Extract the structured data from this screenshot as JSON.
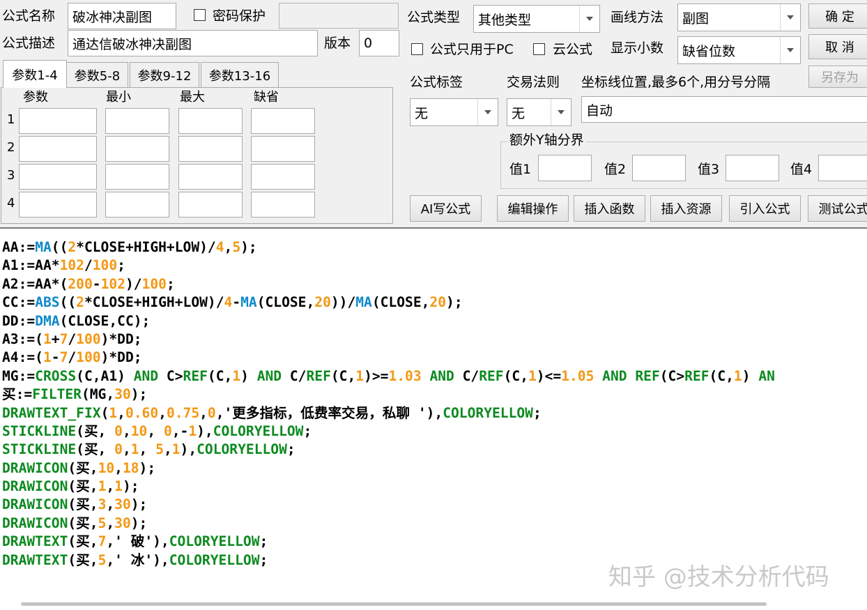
{
  "top": {
    "name_label": "公式名称",
    "name_value": "破冰神决副图",
    "password_label": "密码保护",
    "desc_label": "公式描述",
    "desc_value": "通达信破冰神决副图",
    "version_label": "版本",
    "version_value": "0",
    "type_label": "公式类型",
    "type_value": "其他类型",
    "draw_label": "画线方法",
    "draw_value": "副图",
    "pc_only_label": "公式只用于PC",
    "cloud_label": "云公式",
    "decimals_label": "显示小数",
    "decimals_value": "缺省位数"
  },
  "buttons": {
    "ok": "确  定",
    "cancel": "取  消",
    "save_as": "另存为",
    "ai": "AI写公式",
    "edit": "编辑操作",
    "insert_func": "插入函数",
    "insert_res": "插入资源",
    "import": "引入公式",
    "test": "测试公式"
  },
  "tabs": [
    "参数1-4",
    "参数5-8",
    "参数9-12",
    "参数13-16"
  ],
  "params": {
    "headers": [
      "参数",
      "最小",
      "最大",
      "缺省"
    ],
    "rows": [
      "1",
      "2",
      "3",
      "4"
    ]
  },
  "right": {
    "tag_label": "公式标签",
    "tag_value": "无",
    "trade_label": "交易法则",
    "trade_value": "无",
    "coord_label": "坐标线位置,最多6个,用分号分隔",
    "coord_value": "自动",
    "y_group_title": "额外Y轴分界",
    "y_labels": [
      "值1",
      "值2",
      "值3",
      "值4"
    ]
  },
  "code_lines": [
    [
      [
        "k",
        "AA:="
      ],
      [
        "f",
        "MA"
      ],
      [
        "k",
        "(("
      ],
      [
        "n",
        "2"
      ],
      [
        "k",
        "*CLOSE+HIGH+LOW)/"
      ],
      [
        "n",
        "4"
      ],
      [
        "k",
        ","
      ],
      [
        "n",
        "5"
      ],
      [
        "k",
        ");"
      ]
    ],
    [
      [
        "k",
        "A1:=AA*"
      ],
      [
        "n",
        "102"
      ],
      [
        "k",
        "/"
      ],
      [
        "n",
        "100"
      ],
      [
        "k",
        ";"
      ]
    ],
    [
      [
        "k",
        "A2:=AA*("
      ],
      [
        "n",
        "200"
      ],
      [
        "k",
        "-"
      ],
      [
        "n",
        "102"
      ],
      [
        "k",
        ")/"
      ],
      [
        "n",
        "100"
      ],
      [
        "k",
        ";"
      ]
    ],
    [
      [
        "k",
        "CC:="
      ],
      [
        "f",
        "ABS"
      ],
      [
        "k",
        "(("
      ],
      [
        "n",
        "2"
      ],
      [
        "k",
        "*CLOSE+HIGH+LOW)/"
      ],
      [
        "n",
        "4"
      ],
      [
        "k",
        "-"
      ],
      [
        "f",
        "MA"
      ],
      [
        "k",
        "(CLOSE,"
      ],
      [
        "n",
        "20"
      ],
      [
        "k",
        "))/"
      ],
      [
        "f",
        "MA"
      ],
      [
        "k",
        "(CLOSE,"
      ],
      [
        "n",
        "20"
      ],
      [
        "k",
        ");"
      ]
    ],
    [
      [
        "k",
        "DD:="
      ],
      [
        "f",
        "DMA"
      ],
      [
        "k",
        "(CLOSE,CC);"
      ]
    ],
    [
      [
        "k",
        "A3:=("
      ],
      [
        "n",
        "1"
      ],
      [
        "k",
        "+"
      ],
      [
        "n",
        "7"
      ],
      [
        "k",
        "/"
      ],
      [
        "n",
        "100"
      ],
      [
        "k",
        ")*DD;"
      ]
    ],
    [
      [
        "k",
        "A4:=("
      ],
      [
        "n",
        "1"
      ],
      [
        "k",
        "-"
      ],
      [
        "n",
        "7"
      ],
      [
        "k",
        "/"
      ],
      [
        "n",
        "100"
      ],
      [
        "k",
        ")*DD;"
      ]
    ],
    [
      [
        "k",
        "MG:="
      ],
      [
        "g",
        "CROSS"
      ],
      [
        "k",
        "(C,A1) "
      ],
      [
        "g",
        "AND"
      ],
      [
        "k",
        " C>"
      ],
      [
        "g",
        "REF"
      ],
      [
        "k",
        "(C,"
      ],
      [
        "n",
        "1"
      ],
      [
        "k",
        ") "
      ],
      [
        "g",
        "AND"
      ],
      [
        "k",
        " C/"
      ],
      [
        "g",
        "REF"
      ],
      [
        "k",
        "(C,"
      ],
      [
        "n",
        "1"
      ],
      [
        "k",
        ")>="
      ],
      [
        "n",
        "1.03"
      ],
      [
        "k",
        " "
      ],
      [
        "g",
        "AND"
      ],
      [
        "k",
        " C/"
      ],
      [
        "g",
        "REF"
      ],
      [
        "k",
        "(C,"
      ],
      [
        "n",
        "1"
      ],
      [
        "k",
        ")<="
      ],
      [
        "n",
        "1.05"
      ],
      [
        "k",
        " "
      ],
      [
        "g",
        "AND"
      ],
      [
        "k",
        " "
      ],
      [
        "g",
        "REF"
      ],
      [
        "k",
        "(C>"
      ],
      [
        "g",
        "REF"
      ],
      [
        "k",
        "(C,"
      ],
      [
        "n",
        "1"
      ],
      [
        "k",
        ") "
      ],
      [
        "g",
        "AN"
      ]
    ],
    [
      [
        "k",
        "买:="
      ],
      [
        "g",
        "FILTER"
      ],
      [
        "k",
        "(MG,"
      ],
      [
        "n",
        "30"
      ],
      [
        "k",
        ");"
      ]
    ],
    [
      [
        "g",
        "DRAWTEXT_FIX"
      ],
      [
        "k",
        "("
      ],
      [
        "n",
        "1"
      ],
      [
        "k",
        ","
      ],
      [
        "n",
        "0.60"
      ],
      [
        "k",
        ","
      ],
      [
        "n",
        "0.75"
      ],
      [
        "k",
        ","
      ],
      [
        "n",
        "0"
      ],
      [
        "k",
        ",'更多指标，低费率交易，私聊 '),"
      ],
      [
        "g",
        "COLORYELLOW"
      ],
      [
        "k",
        ";"
      ]
    ],
    [
      [
        "g",
        "STICKLINE"
      ],
      [
        "k",
        "(买, "
      ],
      [
        "n",
        "0"
      ],
      [
        "k",
        ","
      ],
      [
        "n",
        "10"
      ],
      [
        "k",
        ", "
      ],
      [
        "n",
        "0"
      ],
      [
        "k",
        ",-"
      ],
      [
        "n",
        "1"
      ],
      [
        "k",
        "),"
      ],
      [
        "g",
        "COLORYELLOW"
      ],
      [
        "k",
        ";"
      ]
    ],
    [
      [
        "g",
        "STICKLINE"
      ],
      [
        "k",
        "(买, "
      ],
      [
        "n",
        "0"
      ],
      [
        "k",
        ","
      ],
      [
        "n",
        "1"
      ],
      [
        "k",
        ", "
      ],
      [
        "n",
        "5"
      ],
      [
        "k",
        ","
      ],
      [
        "n",
        "1"
      ],
      [
        "k",
        "),"
      ],
      [
        "g",
        "COLORYELLOW"
      ],
      [
        "k",
        ";"
      ]
    ],
    [
      [
        "g",
        "DRAWICON"
      ],
      [
        "k",
        "(买,"
      ],
      [
        "n",
        "10"
      ],
      [
        "k",
        ","
      ],
      [
        "n",
        "18"
      ],
      [
        "k",
        ");"
      ]
    ],
    [
      [
        "g",
        "DRAWICON"
      ],
      [
        "k",
        "(买,"
      ],
      [
        "n",
        "1"
      ],
      [
        "k",
        ","
      ],
      [
        "n",
        "1"
      ],
      [
        "k",
        ");"
      ]
    ],
    [
      [
        "g",
        "DRAWICON"
      ],
      [
        "k",
        "(买,"
      ],
      [
        "n",
        "3"
      ],
      [
        "k",
        ","
      ],
      [
        "n",
        "30"
      ],
      [
        "k",
        ");"
      ]
    ],
    [
      [
        "g",
        "DRAWICON"
      ],
      [
        "k",
        "(买,"
      ],
      [
        "n",
        "5"
      ],
      [
        "k",
        ","
      ],
      [
        "n",
        "30"
      ],
      [
        "k",
        ");"
      ]
    ],
    [
      [
        "g",
        "DRAWTEXT"
      ],
      [
        "k",
        "(买,"
      ],
      [
        "n",
        "7"
      ],
      [
        "k",
        ",' 破'),"
      ],
      [
        "g",
        "COLORYELLOW"
      ],
      [
        "k",
        ";"
      ]
    ],
    [
      [
        "g",
        "DRAWTEXT"
      ],
      [
        "k",
        "(买,"
      ],
      [
        "n",
        "5"
      ],
      [
        "k",
        ",' 冰'),"
      ],
      [
        "g",
        "COLORYELLOW"
      ],
      [
        "k",
        ";"
      ]
    ]
  ],
  "watermark": "知乎 @技术分析代码",
  "colors": {
    "keyword": "#000000",
    "function": "#0f8aca",
    "number": "#f39814",
    "draw_function": "#0d8a20"
  }
}
